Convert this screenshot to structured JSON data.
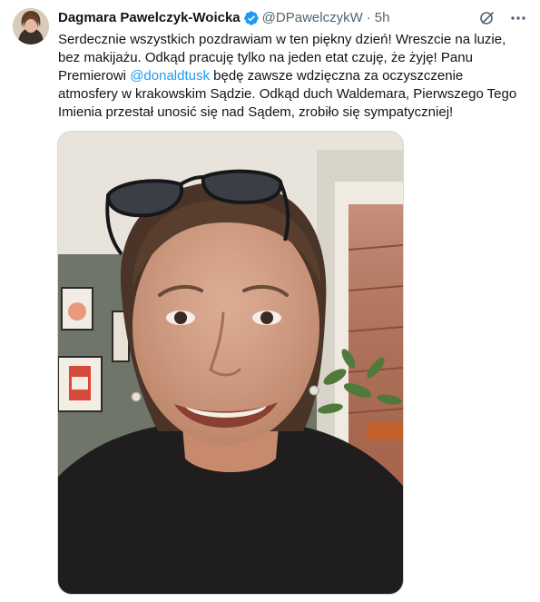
{
  "tweet": {
    "author_name": "Dagmara Pawelczyk-Woicka",
    "handle": "@DPawelczykW",
    "separator": "·",
    "time": "5h",
    "text_before_mention": "Serdecznie wszystkich pozdrawiam w ten piękny dzień! Wreszcie na luzie, bez makijażu. Odkąd pracuję tylko na jeden etat czuję, że żyję! Panu Premierowi ",
    "mention": "@donaldtusk",
    "text_after_mention": " będę zawsze wdzięczna za oczyszczenie atmosfery w krakowskim Sądzie. Odkąd duch Waldemara, Pierwszego Tego Imienia przestał unosić się nad Sądem, zrobiło się sympatyczniej!"
  },
  "icons": {
    "verified": "verified-badge-icon",
    "grok": "grok-icon",
    "more": "more-options-icon"
  },
  "colors": {
    "accent": "#1d9bf0",
    "text": "#0f1419",
    "secondary": "#536471"
  }
}
